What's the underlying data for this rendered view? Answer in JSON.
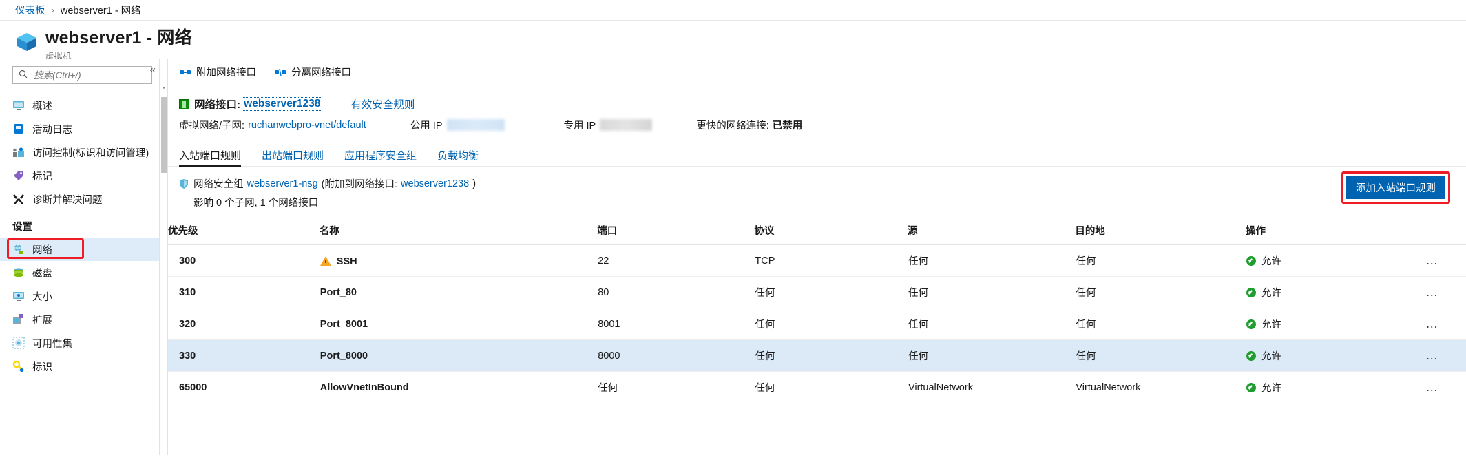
{
  "breadcrumb": {
    "root": "仪表板",
    "separator": "›",
    "current": "webserver1 - 网络"
  },
  "header": {
    "title": "webserver1 - 网络",
    "subtitle": "虚拟机",
    "icon": "virtual-machine-icon"
  },
  "search": {
    "placeholder": "搜索(Ctrl+/)",
    "value": "",
    "icon": "search-icon"
  },
  "sidebar": {
    "collapse_icon": "«",
    "items": [
      {
        "label": "概述",
        "icon": "overview-icon",
        "selected": false
      },
      {
        "label": "活动日志",
        "icon": "activity-log-icon",
        "selected": false
      },
      {
        "label": "访问控制(标识和访问管理)",
        "icon": "access-control-icon",
        "selected": false
      },
      {
        "label": "标记",
        "icon": "tag-icon",
        "selected": false
      },
      {
        "label": "诊断并解决问题",
        "icon": "troubleshoot-icon",
        "selected": false
      }
    ],
    "section_label": "设置",
    "settings_items": [
      {
        "label": "网络",
        "icon": "networking-icon",
        "selected": true,
        "highlighted": true
      },
      {
        "label": "磁盘",
        "icon": "disk-icon",
        "selected": false
      },
      {
        "label": "大小",
        "icon": "size-icon",
        "selected": false
      },
      {
        "label": "扩展",
        "icon": "extensions-icon",
        "selected": false
      },
      {
        "label": "可用性集",
        "icon": "availability-set-icon",
        "selected": false
      },
      {
        "label": "标识",
        "icon": "identity-key-icon",
        "selected": false
      }
    ]
  },
  "toolbar": {
    "attach_label": "附加网络接口",
    "detach_label": "分离网络接口"
  },
  "nic": {
    "prefix": "网络接口:",
    "name": "webserver1238",
    "effective_rules_label": "有效安全规则",
    "vnet_label": "虚拟网络/子网:",
    "vnet_value": "ruchanwebpro-vnet/default",
    "public_ip_label": "公用 IP",
    "public_ip_value": "",
    "private_ip_label": "专用 IP",
    "private_ip_value": "",
    "accelerated_label": "更快的网络连接:",
    "accelerated_value": "已禁用"
  },
  "tabs": [
    {
      "label": "入站端口规则",
      "active": true
    },
    {
      "label": "出站端口规则",
      "active": false
    },
    {
      "label": "应用程序安全组",
      "active": false
    },
    {
      "label": "负载均衡",
      "active": false
    }
  ],
  "nsg": {
    "prefix": "网络安全组",
    "name": "webserver1-nsg",
    "attached_prefix": "(附加到网络接口:",
    "attached_nic": "webserver1238",
    "attached_suffix": ")",
    "impact_text": "影响 0 个子网, 1 个网络接口",
    "add_rule_button": "添加入站端口规则"
  },
  "table": {
    "columns": [
      "优先级",
      "名称",
      "端口",
      "协议",
      "源",
      "目的地",
      "操作"
    ],
    "rows": [
      {
        "priority": "300",
        "name": "SSH",
        "warning": true,
        "port": "22",
        "protocol": "TCP",
        "source": "任何",
        "destination": "任何",
        "action": "允许",
        "menu": "…"
      },
      {
        "priority": "310",
        "name": "Port_80",
        "warning": false,
        "port": "80",
        "protocol": "任何",
        "source": "任何",
        "destination": "任何",
        "action": "允许",
        "menu": "…"
      },
      {
        "priority": "320",
        "name": "Port_8001",
        "warning": false,
        "port": "8001",
        "protocol": "任何",
        "source": "任何",
        "destination": "任何",
        "action": "允许",
        "menu": "…"
      },
      {
        "priority": "330",
        "name": "Port_8000",
        "warning": false,
        "port": "8000",
        "protocol": "任何",
        "source": "任何",
        "destination": "任何",
        "action": "允许",
        "menu": "…"
      },
      {
        "priority": "65000",
        "name": "AllowVnetInBound",
        "warning": false,
        "port": "任何",
        "protocol": "任何",
        "source": "VirtualNetwork",
        "destination": "VirtualNetwork",
        "action": "允许",
        "menu": "…"
      }
    ]
  },
  "colors": {
    "link": "#0063b1",
    "accent_button": "#0063b1",
    "annotation": "#ee1c25",
    "selected_row": "#dce9f7",
    "allow_green": "#1f9d2f",
    "warning_amber": "#f5a623"
  }
}
